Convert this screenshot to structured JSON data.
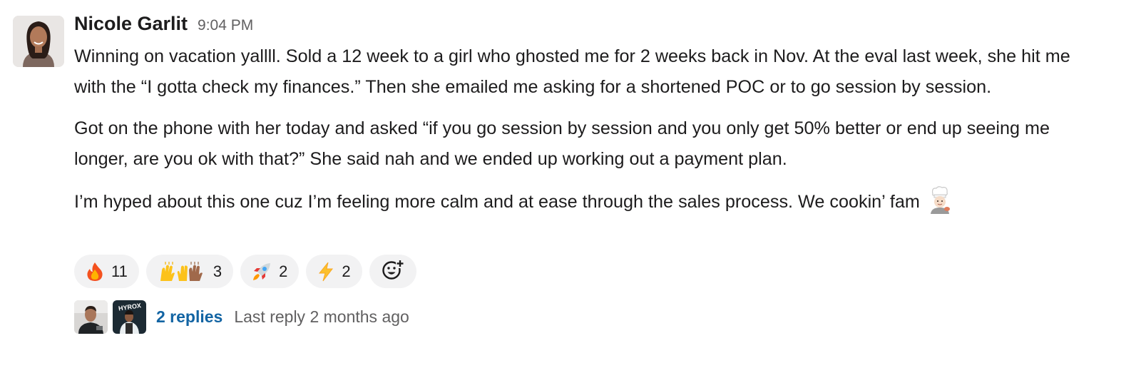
{
  "message": {
    "author": "Nicole Garlit",
    "timestamp": "9:04 PM",
    "paragraphs": [
      "Winning on vacation yallll. Sold a 12 week to a girl who ghosted me for 2 weeks back in Nov. At the eval last week, she hit me with the “I gotta check my finances.” Then she emailed me asking for a shortened POC or to go session by session.",
      "Got on the phone with her today and asked “if you go session by session and you only get 50% better or end up seeing me longer, are you ok with that?” She said nah and we ended up working out a payment plan.",
      "I’m hyped about this one cuz I’m feeling more calm and at ease through the sales process. We cookin’ fam"
    ],
    "trailing_emoji": "woman-cook-light-skin-tone"
  },
  "reactions": [
    {
      "emoji": "fire",
      "count": "11"
    },
    {
      "emoji": "raised-hands-medium-dark-skin-tone",
      "count": "3"
    },
    {
      "emoji": "rocket",
      "count": "2"
    },
    {
      "emoji": "zap",
      "count": "2"
    }
  ],
  "add_reaction_icon": "add-reaction-icon",
  "thread": {
    "reply_count": "2 replies",
    "last_reply": "Last reply 2 months ago"
  },
  "colors": {
    "link": "#1264a3",
    "muted": "#616061",
    "reaction_bg": "#f2f2f3"
  }
}
